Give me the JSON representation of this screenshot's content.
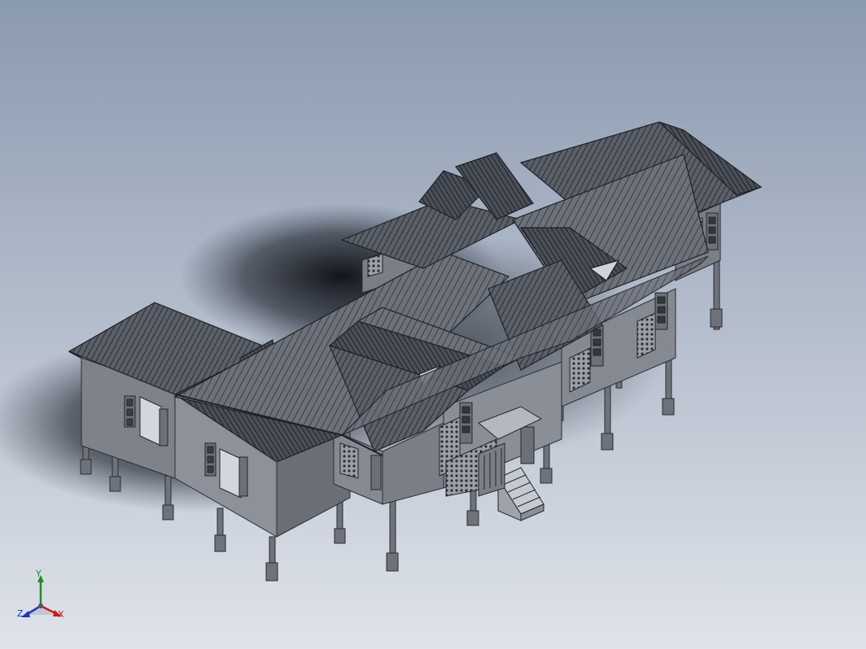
{
  "viewport": {
    "background_top": "#8a9ab0",
    "background_bottom": "#dfe3ea",
    "model": "3d-house-model"
  },
  "triad": {
    "x_label": "X",
    "y_label": "Y",
    "z_label": "Z",
    "colors": {
      "x": "#c21d1d",
      "y": "#1c8f1c",
      "z": "#2533b8"
    }
  }
}
